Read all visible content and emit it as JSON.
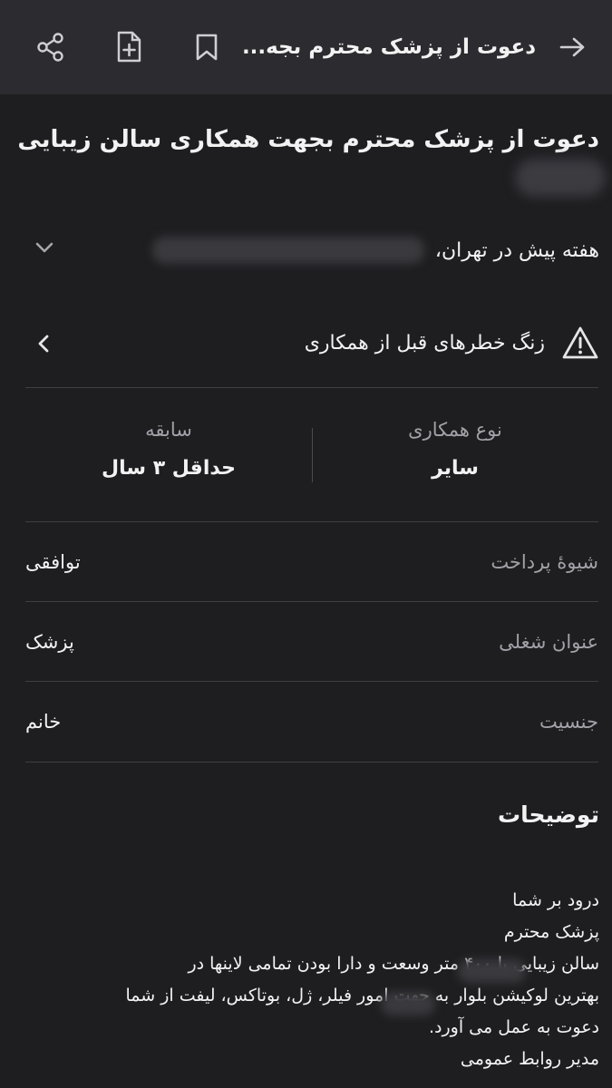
{
  "header": {
    "title": "دعوت از پزشک محترم بجه...",
    "icons": [
      "back-arrow-icon",
      "bookmark-icon",
      "note-add-icon",
      "share-icon"
    ]
  },
  "ad": {
    "title": "دعوت از پزشک محترم بجهت همکاری سالن زیبایی",
    "meta": "هفته پیش در تهران،",
    "warning": "زنگ خطرهای قبل از همکاری",
    "stats": [
      {
        "label": "نوع همکاری",
        "value": "سایر"
      },
      {
        "label": "سابقه",
        "value": "حداقل ۳ سال"
      }
    ],
    "fields": [
      {
        "label": "شیوهٔ پرداخت",
        "value": "توافقی"
      },
      {
        "label": "عنوان شغلی",
        "value": "پزشک"
      },
      {
        "label": "جنسیت",
        "value": "خانم"
      }
    ],
    "description_heading": "توضیحات",
    "description_lines": [
      "درود بر شما",
      "پزشک محترم",
      "سالن زیبایی            با ۴۰۰ متر وسعت و دارا بودن تمامی لاینها در",
      "بهترین لوکیشن بلوار          به جهت امور فیلر، ژل، بوتاکس، لیفت از شما",
      "دعوت به عمل می آورد.",
      "مدیر روابط عمومی"
    ]
  }
}
